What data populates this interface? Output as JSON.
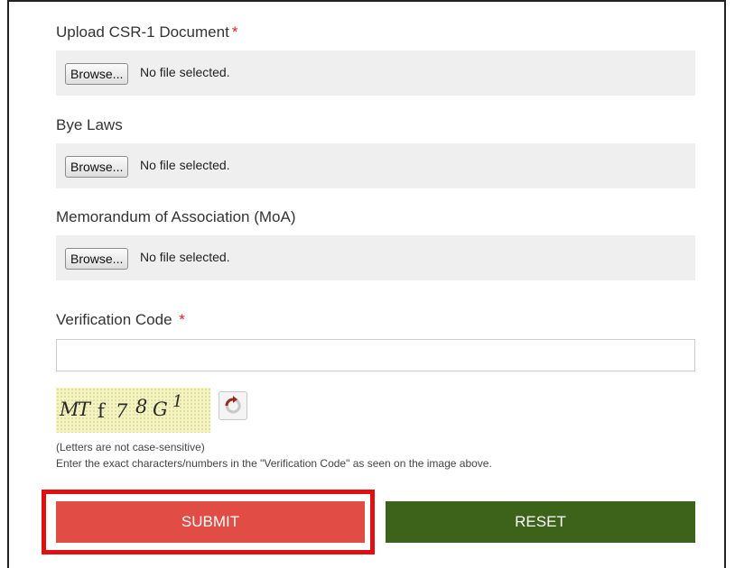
{
  "form": {
    "csr_document": {
      "label": "Upload CSR-1 Document",
      "required_mark": "*",
      "browse_label": "Browse...",
      "status": "No file selected."
    },
    "bye_laws": {
      "label": "Bye Laws",
      "browse_label": "Browse...",
      "status": "No file selected."
    },
    "moa": {
      "label": "Memorandum of Association (MoA)",
      "browse_label": "Browse...",
      "status": "No file selected."
    },
    "verification": {
      "label": "Verification Code",
      "required_mark": "*",
      "value": "",
      "captcha_chars": [
        "M",
        "T",
        "f",
        "7",
        "8",
        "G",
        "1"
      ],
      "refresh_icon": "refresh-arrow-icon",
      "note_case": "(Letters are not case-sensitive)",
      "note_instructions": "Enter the exact characters/numbers in the \"Verification Code\" as seen on the image above."
    },
    "buttons": {
      "submit_label": "SUBMIT",
      "reset_label": "RESET"
    }
  },
  "colors": {
    "submit_bg": "#e14c45",
    "reset_bg": "#3d631a",
    "highlight_outline": "#e01010",
    "required_mark": "#e02020"
  }
}
